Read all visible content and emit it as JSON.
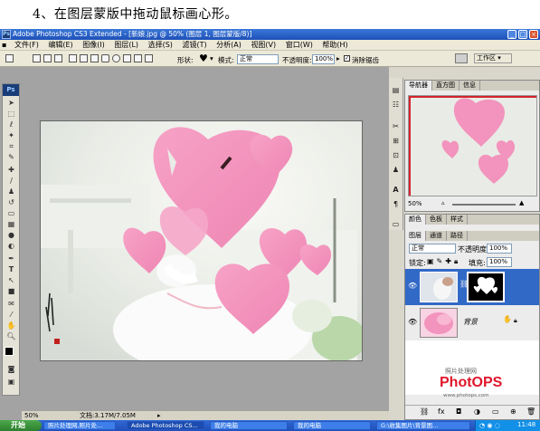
{
  "caption": "4、在图层蒙版中拖动鼠标画心形。",
  "app": {
    "title": "Adobe Photoshop CS3 Extended - [新娘.jpg @ 50% (图层 1, 图层蒙版/8)]",
    "icon": "Ps"
  },
  "menu": [
    "文件(F)",
    "编辑(E)",
    "图像(I)",
    "图层(L)",
    "选择(S)",
    "滤镜(T)",
    "分析(A)",
    "视图(V)",
    "窗口(W)",
    "帮助(H)"
  ],
  "options": {
    "shape_label": "形状:",
    "mode_label": "模式:",
    "mode_value": "正常",
    "opacity_label": "不透明度:",
    "opacity_value": "100%",
    "antialias_label": "消除锯齿",
    "workspace_label": "工作区 ▾"
  },
  "status": {
    "zoom": "50%",
    "doc": "文档:3.17M/7.05M"
  },
  "navigator": {
    "tabs": [
      "导航器",
      "直方图",
      "信息"
    ],
    "zoom": "50%"
  },
  "layers": {
    "tabs_top": [
      "颜色",
      "色板",
      "样式"
    ],
    "tabs": [
      "图层",
      "通道",
      "路径"
    ],
    "blend_mode": "正常",
    "opacity_label": "不透明度:",
    "opacity_value": "100%",
    "lock_label": "锁定:",
    "fill_label": "填充:",
    "fill_value": "100%",
    "background_name": "背景"
  },
  "watermark": {
    "line1": "照片处理网",
    "logo": "PhotOPS",
    "url": "www.photops.com"
  },
  "taskbar": {
    "start": "开始",
    "tasks": [
      "照片处理网,照片处...",
      "Adobe Photoshop CS...",
      "我的电脑",
      "我的电脑",
      "G:\\收集图片\\背景图..."
    ],
    "clock": "11:48"
  },
  "colors": {
    "accent": "#1e50b8",
    "heart": "#f294bd"
  }
}
